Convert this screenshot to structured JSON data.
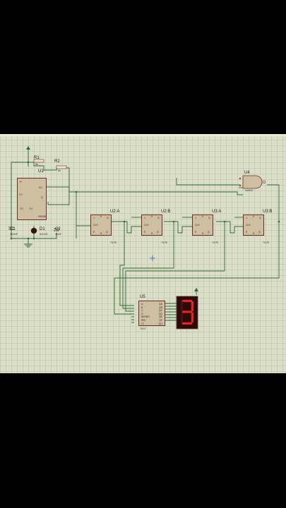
{
  "colors": {
    "wire": "#2f6b2f",
    "outline": "#6b2d2d",
    "body": "#cdbfa0",
    "segment_on": "#e8231a",
    "segment_off": "#4a0e0c",
    "grid": "#c9ccb4",
    "sheet": "#dcdfc8"
  },
  "timer": {
    "ref": "U1",
    "part": "NE555",
    "pins": {
      "r": "R",
      "dc": "DC",
      "cv": "CV",
      "tr": "TR",
      "th": "TH",
      "q": "Q"
    }
  },
  "r1": {
    "ref": "R1",
    "value": "5k"
  },
  "r2": {
    "ref": "R2",
    "value": "5k"
  },
  "c1": {
    "ref": "C1",
    "value": "100nF"
  },
  "c2": {
    "ref": "C2",
    "value": "10nF"
  },
  "d1": {
    "ref": "D1",
    "value": "AGUH"
  },
  "flipflops": [
    {
      "ref": "U2:A",
      "part": "7476"
    },
    {
      "ref": "U2:B",
      "part": "7476"
    },
    {
      "ref": "U3:A",
      "part": "7476"
    },
    {
      "ref": "U3:B",
      "part": "7476"
    }
  ],
  "ff_pins": {
    "j": "J",
    "k": "K",
    "clk": "CLK",
    "q": "Q",
    "qn": "Q̄",
    "s": "S",
    "r": "R"
  },
  "nand": {
    "ref": "U4",
    "part": "NAND"
  },
  "decoder": {
    "ref": "U5",
    "part": "7447",
    "inputs": [
      "A",
      "B",
      "C",
      "D",
      "BI/RBO",
      "RBI",
      "LT"
    ],
    "outputs": [
      "QA",
      "QB",
      "QC",
      "QD",
      "QE",
      "QF",
      "QG"
    ]
  },
  "display": {
    "digit": 3
  }
}
